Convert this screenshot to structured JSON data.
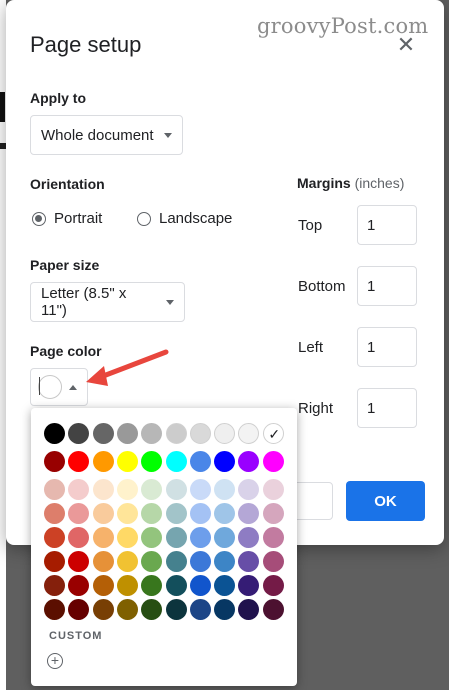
{
  "watermark": "groovyPost.com",
  "dialog": {
    "title": "Page setup",
    "apply_to": {
      "label": "Apply to",
      "value": "Whole document"
    },
    "orientation": {
      "label": "Orientation",
      "options": [
        {
          "label": "Portrait",
          "selected": true
        },
        {
          "label": "Landscape",
          "selected": false
        }
      ]
    },
    "paper_size": {
      "label": "Paper size",
      "value": "Letter (8.5\" x 11\")"
    },
    "page_color": {
      "label": "Page color",
      "value": "#ffffff"
    },
    "margins": {
      "label": "Margins",
      "unit": "(inches)",
      "fields": [
        {
          "label": "Top",
          "value": "1"
        },
        {
          "label": "Bottom",
          "value": "1"
        },
        {
          "label": "Left",
          "value": "1"
        },
        {
          "label": "Right",
          "value": "1"
        }
      ]
    },
    "ok_label": "OK"
  },
  "palette": {
    "custom_label": "CUSTOM",
    "selected": "#ffffff",
    "rows": [
      [
        "#000000",
        "#434343",
        "#666666",
        "#999999",
        "#b7b7b7",
        "#cccccc",
        "#d9d9d9",
        "#efefef",
        "#f3f3f3",
        "#ffffff"
      ],
      [
        "#980000",
        "#ff0000",
        "#ff9900",
        "#ffff00",
        "#00ff00",
        "#00ffff",
        "#4a86e8",
        "#0000ff",
        "#9900ff",
        "#ff00ff"
      ],
      [
        "#e6b8af",
        "#f4cccc",
        "#fce5cd",
        "#fff2cc",
        "#d9ead3",
        "#d0e0e3",
        "#c9daf8",
        "#cfe2f3",
        "#d9d2e9",
        "#ead1dc"
      ],
      [
        "#dd7e6b",
        "#ea9999",
        "#f9cb9c",
        "#ffe599",
        "#b6d7a8",
        "#a2c4c9",
        "#a4c2f4",
        "#9fc5e8",
        "#b4a7d6",
        "#d5a6bd"
      ],
      [
        "#cc4125",
        "#e06666",
        "#f6b26b",
        "#ffd966",
        "#93c47d",
        "#76a5af",
        "#6d9eeb",
        "#6fa8dc",
        "#8e7cc3",
        "#c27ba0"
      ],
      [
        "#a61c00",
        "#cc0000",
        "#e69138",
        "#f1c232",
        "#6aa84f",
        "#45818e",
        "#3c78d8",
        "#3d85c6",
        "#674ea7",
        "#a64d79"
      ],
      [
        "#85200c",
        "#990000",
        "#b45f06",
        "#bf9000",
        "#38761d",
        "#134f5c",
        "#1155cc",
        "#0b5394",
        "#351c75",
        "#741b47"
      ],
      [
        "#5b0f00",
        "#660000",
        "#783f04",
        "#7f6000",
        "#274e13",
        "#0c343d",
        "#1c4587",
        "#073763",
        "#20124d",
        "#4c1130"
      ]
    ]
  }
}
